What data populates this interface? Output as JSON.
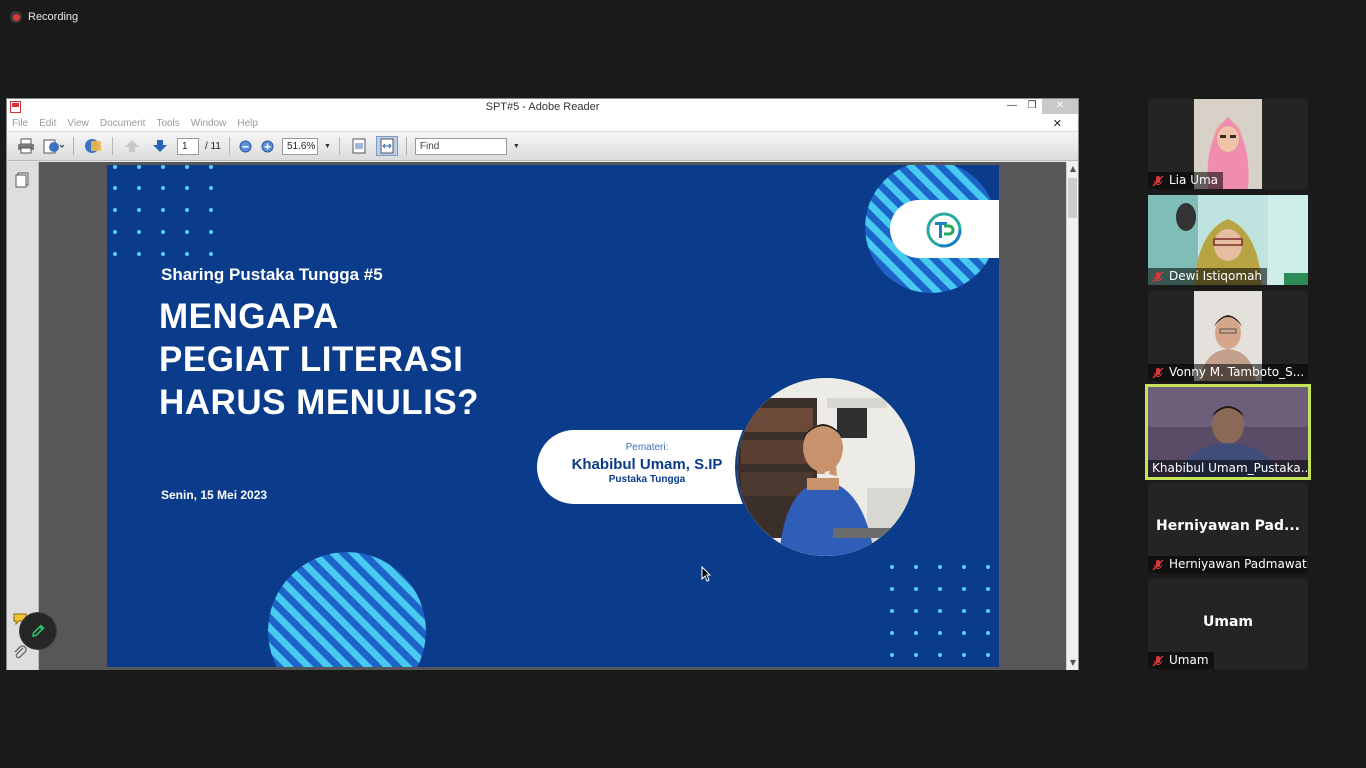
{
  "recording": {
    "label": "Recording"
  },
  "reader": {
    "window_title": "SPT#5 - Adobe Reader",
    "menu": [
      "File",
      "Edit",
      "View",
      "Document",
      "Tools",
      "Window",
      "Help"
    ],
    "page_current": "1",
    "page_total": "/ 11",
    "zoom": "51.6%",
    "find_placeholder": "Find"
  },
  "slide": {
    "subtitle": "Sharing Pustaka Tungga #5",
    "headline": [
      "MENGAPA",
      "PEGIAT LITERASI",
      "HARUS MENULIS?"
    ],
    "date": "Senin, 15 Mei 2023",
    "speaker_label": "Pemateri:",
    "speaker_name": "Khabibul Umam, S.IP",
    "speaker_org": "Pustaka Tungga"
  },
  "participants": [
    {
      "name": "Lia Uma",
      "video": true,
      "muted": true
    },
    {
      "name": "Dewi Istiqomah",
      "video": true,
      "muted": true
    },
    {
      "name": "Vonny M. Tamboto_S...",
      "video": true,
      "muted": true
    },
    {
      "name": "Khabibul Umam_Pustaka...",
      "video": true,
      "muted": false,
      "active": true
    },
    {
      "name": "Herniyawan Padmawati",
      "display": "Herniyawan  Pad...",
      "video": false,
      "muted": true
    },
    {
      "name": "Umam",
      "display": "Umam",
      "video": false,
      "muted": true
    }
  ],
  "colors": {
    "slide_bg": "#0b3c8c",
    "active_speaker": "#c6e35a",
    "recording": "#e0363b"
  }
}
